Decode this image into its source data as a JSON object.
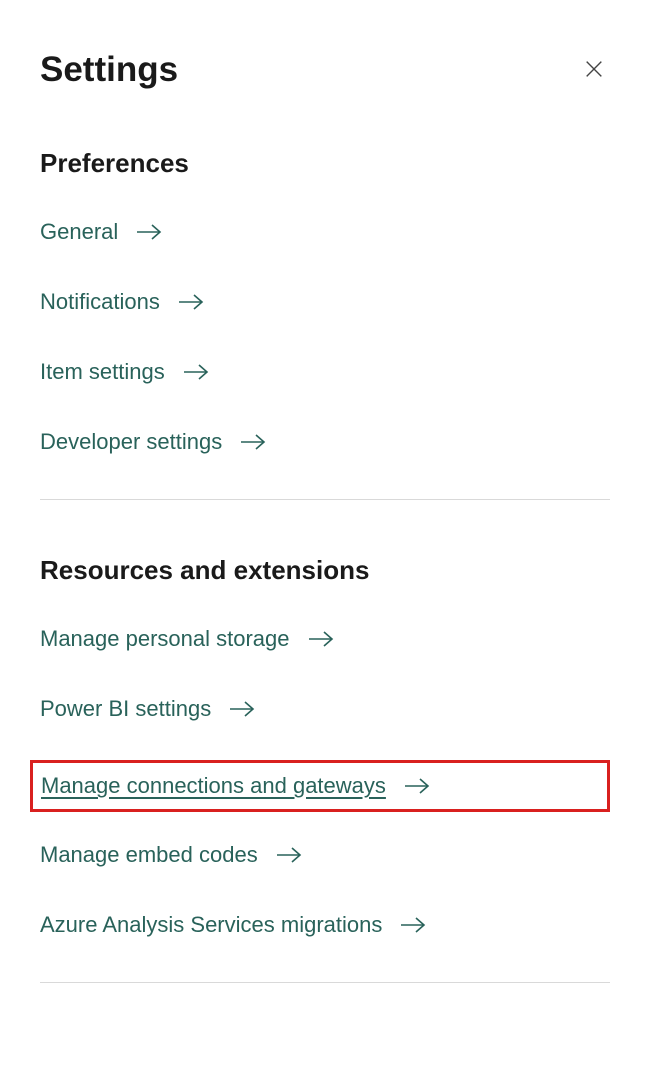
{
  "header": {
    "title": "Settings"
  },
  "sections": {
    "preferences": {
      "title": "Preferences",
      "items": [
        {
          "label": "General"
        },
        {
          "label": "Notifications"
        },
        {
          "label": "Item settings"
        },
        {
          "label": "Developer settings"
        }
      ]
    },
    "resources": {
      "title": "Resources and extensions",
      "items": [
        {
          "label": "Manage personal storage"
        },
        {
          "label": "Power BI settings"
        },
        {
          "label": "Manage connections and gateways"
        },
        {
          "label": "Manage embed codes"
        },
        {
          "label": "Azure Analysis Services migrations"
        }
      ]
    }
  }
}
